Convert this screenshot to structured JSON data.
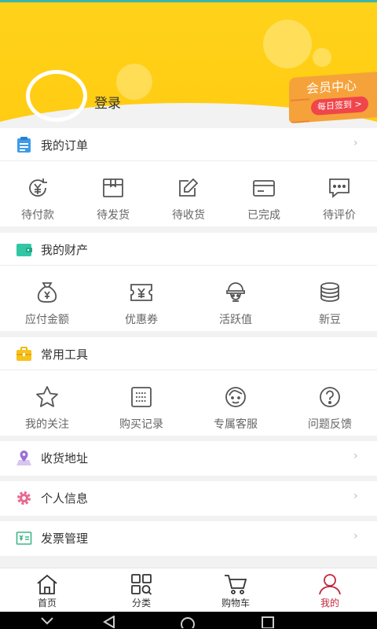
{
  "header": {
    "login_label": "登录",
    "member_center": "会员中心",
    "daily_checkin": "每日签到 >"
  },
  "orders": {
    "title": "我的订单",
    "items": [
      {
        "label": "待付款",
        "icon": "pending-payment-icon"
      },
      {
        "label": "待发货",
        "icon": "pending-shipment-icon"
      },
      {
        "label": "待收货",
        "icon": "pending-receipt-icon"
      },
      {
        "label": "已完成",
        "icon": "completed-icon"
      },
      {
        "label": "待评价",
        "icon": "pending-review-icon"
      }
    ]
  },
  "assets": {
    "title": "我的财产",
    "items": [
      {
        "label": "应付金额",
        "icon": "money-bag-icon"
      },
      {
        "label": "优惠券",
        "icon": "coupon-icon"
      },
      {
        "label": "活跃值",
        "icon": "activity-icon"
      },
      {
        "label": "新豆",
        "icon": "coins-icon"
      }
    ]
  },
  "tools": {
    "title": "常用工具",
    "items": [
      {
        "label": "我的关注",
        "icon": "star-icon"
      },
      {
        "label": "购买记录",
        "icon": "purchase-record-icon"
      },
      {
        "label": "专属客服",
        "icon": "customer-service-icon"
      },
      {
        "label": "问题反馈",
        "icon": "question-icon"
      }
    ]
  },
  "rows": {
    "address": "收货地址",
    "profile": "个人信息",
    "invoice": "发票管理"
  },
  "tabbar": {
    "home": "首页",
    "category": "分类",
    "cart": "购物车",
    "mine": "我的"
  },
  "colors": {
    "header": "#ffcc12",
    "accent": "#c0283b",
    "member_badge": "#f6a23a"
  }
}
